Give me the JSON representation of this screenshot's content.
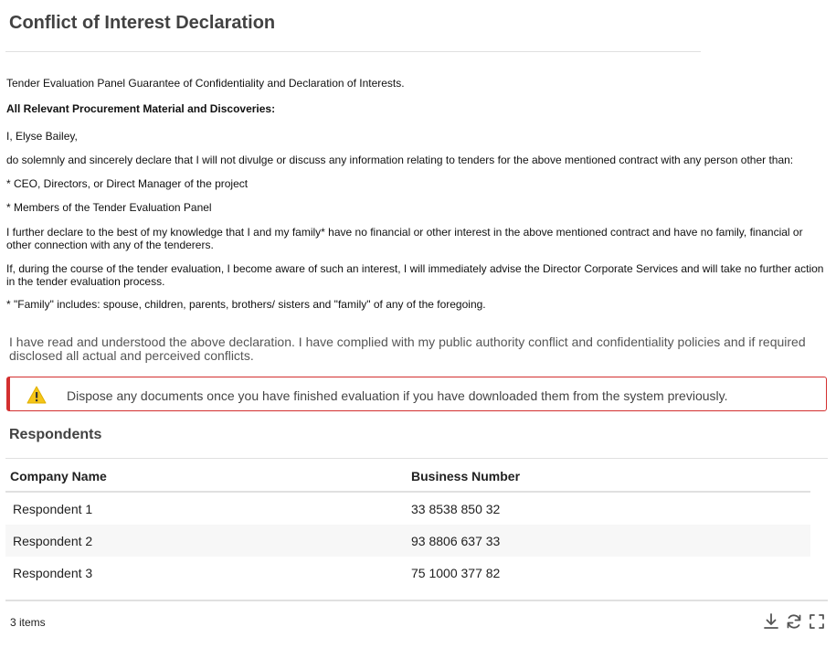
{
  "page": {
    "title": "Conflict of Interest Declaration"
  },
  "declaration": {
    "intro": "Tender Evaluation Panel Guarantee of Confidentiality and Declaration of Interests.",
    "heading": "All Relevant Procurement Material and Discoveries:",
    "greeting": "I, Elyse Bailey,",
    "statement": "do solemnly and sincerely declare that I will not divulge or discuss any information relating to tenders for the above mentioned contract with any person other than:",
    "bullet_1": "* CEO, Directors, or Direct Manager of the project",
    "bullet_2": "* Members of the Tender Evaluation Panel",
    "further": "I further declare to the best of my knowledge that I and my family* have no financial or other interest in the above mentioned contract and have no family, financial or other connection with any of the tenderers.",
    "if_during": "If, during the course of the tender evaluation, I become aware of such an interest, I will immediately advise the Director Corporate Services and will take no further action in the tender evaluation process.",
    "family_note": "* \"Family\" includes: spouse, children, parents, brothers/ sisters and \"family\" of any of the foregoing."
  },
  "acknowledgement": "I have read and understood the above declaration. I have complied with my public authority conflict and confidentiality policies and if required disclosed all actual and perceived conflicts.",
  "alert": {
    "icon": "warning-icon",
    "text": "Dispose any documents once you have finished evaluation if you have downloaded them from the system previously.",
    "color": "#d32f2f",
    "icon_color": "#f5c518"
  },
  "respondents": {
    "title": "Respondents",
    "columns": [
      "Company Name",
      "Business Number"
    ],
    "rows": [
      [
        "Respondent 1",
        "33 8538 850 32"
      ],
      [
        "Respondent 2",
        "93 8806 637 33"
      ],
      [
        "Respondent 3",
        "75 1000 377 82"
      ]
    ],
    "item_count": "3 items",
    "tools": [
      "download-icon",
      "refresh-icon",
      "fullscreen-icon"
    ]
  }
}
